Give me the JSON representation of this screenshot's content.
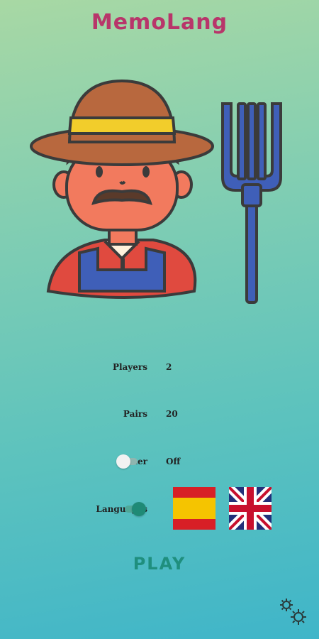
{
  "app": {
    "title": "MemoLang"
  },
  "settings": {
    "players": {
      "label": "Players",
      "value": "2"
    },
    "pairs": {
      "label": "Pairs",
      "value": "20"
    },
    "timer": {
      "label": "Timer",
      "value": "Off",
      "enabled": false
    },
    "languages": {
      "label": "Languages",
      "enabled": true,
      "flags": [
        "spain-flag",
        "uk-flag"
      ]
    }
  },
  "play_button": {
    "label": "PLAY"
  },
  "icons": {
    "settings": "gears-icon"
  },
  "colors": {
    "title": "#b8356a",
    "play": "#1f8f7e",
    "toggle_on": "#1f8a76",
    "toggle_off": "#f2f2f2"
  }
}
